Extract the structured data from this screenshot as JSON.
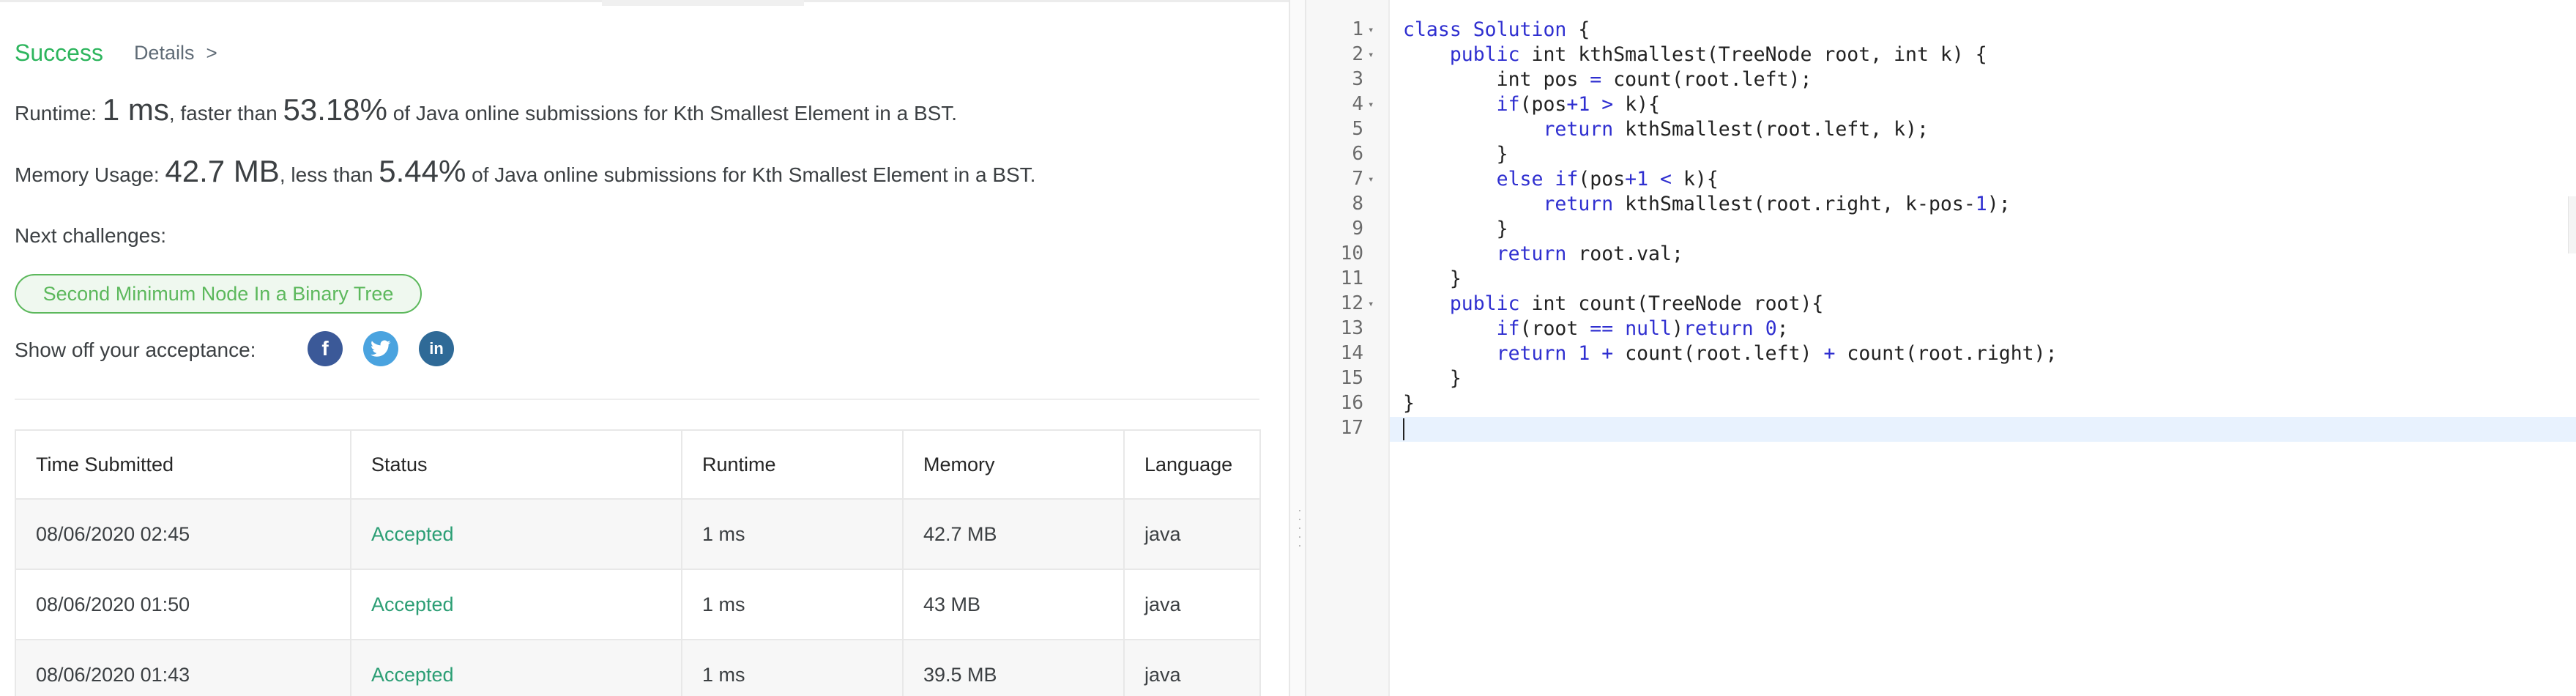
{
  "result": {
    "status": "Success",
    "details_label": "Details",
    "details_chevron": ">",
    "runtime": {
      "prefix": "Runtime: ",
      "value": "1 ms",
      "mid": ", faster than ",
      "percent": "53.18%",
      "suffix": " of Java online submissions for Kth Smallest Element in a BST."
    },
    "memory": {
      "prefix": "Memory Usage: ",
      "value": "42.7 MB",
      "mid": ", less than ",
      "percent": "5.44%",
      "suffix": " of Java online submissions for Kth Smallest Element in a BST."
    },
    "next_challenges_label": "Next challenges:",
    "next_challenge": "Second Minimum Node In a Binary Tree",
    "share_label": "Show off your acceptance:",
    "social": {
      "facebook": {
        "icon": "facebook-icon",
        "glyph": "f",
        "color": "#3b5998"
      },
      "twitter": {
        "icon": "twitter-icon",
        "color": "#4aa3df"
      },
      "linkedin": {
        "icon": "linkedin-icon",
        "glyph": "in",
        "color": "#2f6a97"
      }
    }
  },
  "table": {
    "headers": {
      "time": "Time Submitted",
      "status": "Status",
      "runtime": "Runtime",
      "memory": "Memory",
      "language": "Language"
    },
    "rows": [
      {
        "time": "08/06/2020 02:45",
        "status": "Accepted",
        "runtime": "1 ms",
        "memory": "42.7 MB",
        "language": "java"
      },
      {
        "time": "08/06/2020 01:50",
        "status": "Accepted",
        "runtime": "1 ms",
        "memory": "43 MB",
        "language": "java"
      },
      {
        "time": "08/06/2020 01:43",
        "status": "Accepted",
        "runtime": "1 ms",
        "memory": "39.5 MB",
        "language": "java"
      }
    ]
  },
  "editor": {
    "lines": [
      {
        "num": "1",
        "fold": true,
        "segments": [
          {
            "t": "class Solution",
            "c": "kw"
          },
          {
            "t": " {",
            "c": ""
          }
        ]
      },
      {
        "num": "2",
        "fold": true,
        "segments": [
          {
            "t": "    ",
            "c": ""
          },
          {
            "t": "public",
            "c": "kw"
          },
          {
            "t": " int kthSmallest(TreeNode root, int k) {",
            "c": ""
          }
        ]
      },
      {
        "num": "3",
        "fold": false,
        "segments": [
          {
            "t": "        int pos ",
            "c": ""
          },
          {
            "t": "=",
            "c": "op"
          },
          {
            "t": " count(root.left);",
            "c": ""
          }
        ]
      },
      {
        "num": "4",
        "fold": true,
        "segments": [
          {
            "t": "        ",
            "c": ""
          },
          {
            "t": "if",
            "c": "kw"
          },
          {
            "t": "(pos",
            "c": ""
          },
          {
            "t": "+1",
            "c": "num"
          },
          {
            "t": " ",
            "c": ""
          },
          {
            "t": ">",
            "c": "op"
          },
          {
            "t": " k){",
            "c": ""
          }
        ]
      },
      {
        "num": "5",
        "fold": false,
        "segments": [
          {
            "t": "            ",
            "c": ""
          },
          {
            "t": "return",
            "c": "kw"
          },
          {
            "t": " kthSmallest(root.left, k);",
            "c": ""
          }
        ]
      },
      {
        "num": "6",
        "fold": false,
        "segments": [
          {
            "t": "        }",
            "c": ""
          }
        ]
      },
      {
        "num": "7",
        "fold": true,
        "segments": [
          {
            "t": "        ",
            "c": ""
          },
          {
            "t": "else if",
            "c": "kw"
          },
          {
            "t": "(pos",
            "c": ""
          },
          {
            "t": "+1",
            "c": "num"
          },
          {
            "t": " ",
            "c": ""
          },
          {
            "t": "<",
            "c": "op"
          },
          {
            "t": " k){",
            "c": ""
          }
        ]
      },
      {
        "num": "8",
        "fold": false,
        "segments": [
          {
            "t": "            ",
            "c": ""
          },
          {
            "t": "return",
            "c": "kw"
          },
          {
            "t": " kthSmallest(root.right, k-pos-",
            "c": ""
          },
          {
            "t": "1",
            "c": "num"
          },
          {
            "t": ");",
            "c": ""
          }
        ]
      },
      {
        "num": "9",
        "fold": false,
        "segments": [
          {
            "t": "        }",
            "c": ""
          }
        ]
      },
      {
        "num": "10",
        "fold": false,
        "segments": [
          {
            "t": "        ",
            "c": ""
          },
          {
            "t": "return",
            "c": "kw"
          },
          {
            "t": " root.val;",
            "c": ""
          }
        ]
      },
      {
        "num": "11",
        "fold": false,
        "segments": [
          {
            "t": "    }",
            "c": ""
          }
        ]
      },
      {
        "num": "12",
        "fold": true,
        "segments": [
          {
            "t": "    ",
            "c": ""
          },
          {
            "t": "public",
            "c": "kw"
          },
          {
            "t": " int count(TreeNode root){",
            "c": ""
          }
        ]
      },
      {
        "num": "13",
        "fold": false,
        "segments": [
          {
            "t": "        ",
            "c": ""
          },
          {
            "t": "if",
            "c": "kw"
          },
          {
            "t": "(root ",
            "c": ""
          },
          {
            "t": "==",
            "c": "op"
          },
          {
            "t": " ",
            "c": ""
          },
          {
            "t": "null",
            "c": "kw"
          },
          {
            "t": ")",
            "c": ""
          },
          {
            "t": "return",
            "c": "kw"
          },
          {
            "t": " ",
            "c": ""
          },
          {
            "t": "0",
            "c": "num"
          },
          {
            "t": ";",
            "c": ""
          }
        ]
      },
      {
        "num": "14",
        "fold": false,
        "segments": [
          {
            "t": "        ",
            "c": ""
          },
          {
            "t": "return",
            "c": "kw"
          },
          {
            "t": " ",
            "c": ""
          },
          {
            "t": "1",
            "c": "num"
          },
          {
            "t": " ",
            "c": ""
          },
          {
            "t": "+",
            "c": "op"
          },
          {
            "t": " count(root.left) ",
            "c": ""
          },
          {
            "t": "+",
            "c": "op"
          },
          {
            "t": " count(root.right);",
            "c": ""
          }
        ]
      },
      {
        "num": "15",
        "fold": false,
        "segments": [
          {
            "t": "    }",
            "c": ""
          }
        ]
      },
      {
        "num": "16",
        "fold": false,
        "segments": [
          {
            "t": "}",
            "c": ""
          }
        ]
      },
      {
        "num": "17",
        "fold": false,
        "segments": []
      }
    ],
    "colors": {
      "keyword": "#2f2fd0",
      "text": "#222222",
      "active_line": "#e8f2fe"
    }
  }
}
